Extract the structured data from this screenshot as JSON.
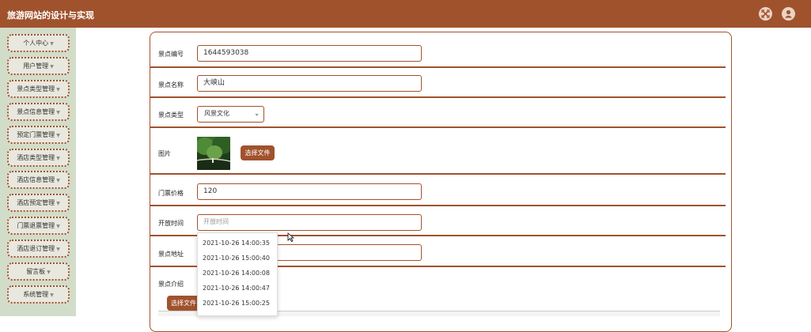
{
  "app": {
    "title": "旅游网站的设计与实现"
  },
  "header": {
    "fullscreen_icon": "fullscreen-icon",
    "user_icon": "user-icon"
  },
  "sidebar": {
    "items": [
      {
        "label": "个人中心"
      },
      {
        "label": "用户管理"
      },
      {
        "label": "景点类型管理"
      },
      {
        "label": "景点信息管理"
      },
      {
        "label": "预定门票管理"
      },
      {
        "label": "酒店类型管理"
      },
      {
        "label": "酒店信息管理"
      },
      {
        "label": "酒店预定管理"
      },
      {
        "label": "门票退票管理"
      },
      {
        "label": "酒店退订管理"
      },
      {
        "label": "留言板"
      },
      {
        "label": "系统管理"
      }
    ]
  },
  "form": {
    "id_label": "景点编号",
    "id_value": "1644593038",
    "name_label": "景点名称",
    "name_value": "大峡山",
    "type_label": "景点类型",
    "type_value": "风景文化",
    "image_label": "图片",
    "choose_file": "选择文件",
    "price_label": "门票价格",
    "price_value": "120",
    "open_time_label": "开放时间",
    "open_time_placeholder": "开放时间",
    "address_label": "景点地址",
    "intro_label": "景点介绍",
    "intro_choose_file": "选择文件"
  },
  "time_dropdown": {
    "options": [
      "2021-10-26 14:00:35",
      "2021-10-26 15:00:40",
      "2021-10-26 14:00:08",
      "2021-10-26 14:00:47",
      "2021-10-26 15:00:25"
    ]
  },
  "colors": {
    "accent": "#a0522d",
    "sidebar_bg": "#d2ddc9"
  }
}
